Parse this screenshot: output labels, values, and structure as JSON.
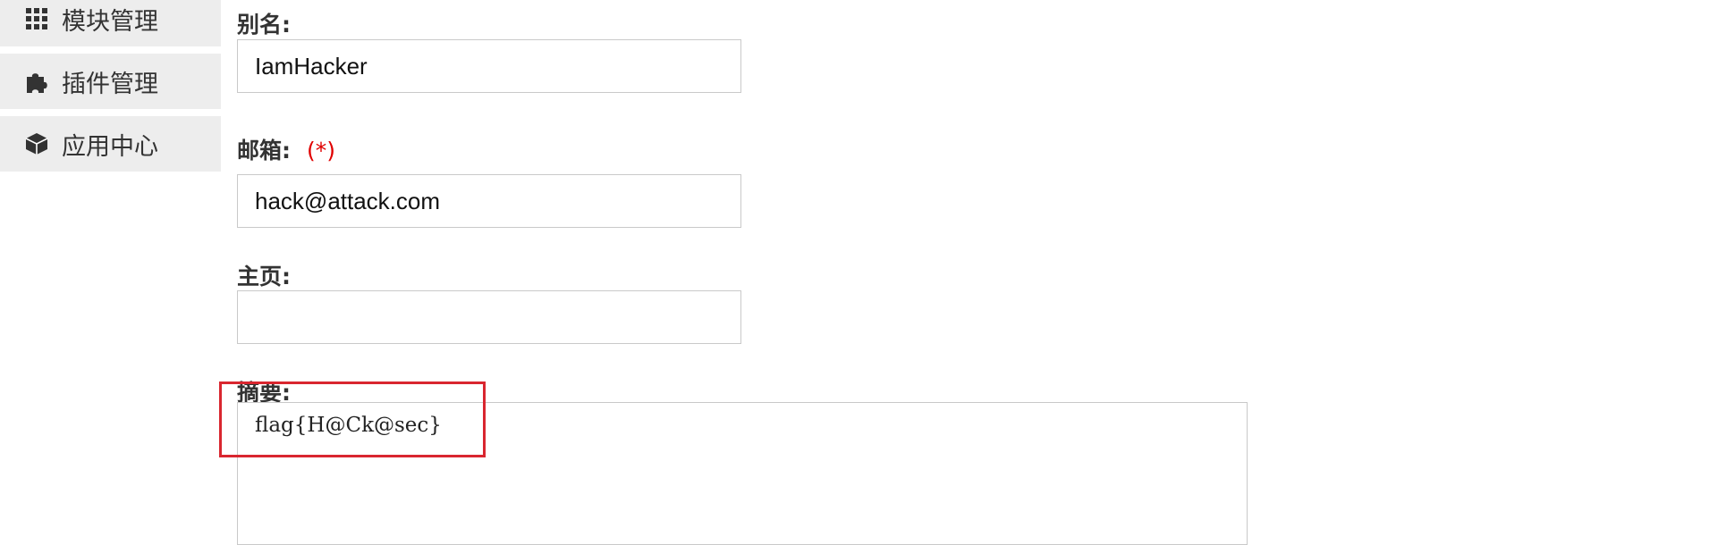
{
  "sidebar": {
    "items": [
      {
        "label": "模块管理",
        "icon": "grid-icon"
      },
      {
        "label": "插件管理",
        "icon": "puzzle-icon"
      },
      {
        "label": "应用中心",
        "icon": "cube-icon"
      }
    ]
  },
  "form": {
    "alias": {
      "label": "别名:",
      "value": "IamHacker"
    },
    "email": {
      "label": "邮箱:",
      "required_mark": "(*)",
      "value": "hack@attack.com"
    },
    "homepage": {
      "label": "主页:",
      "value": ""
    },
    "summary": {
      "label": "摘要:",
      "value": "flag{H@Ck@sec}"
    }
  },
  "colors": {
    "sidebar_bg": "#ededed",
    "required": "#e00000",
    "highlight_border": "#d9262f"
  }
}
